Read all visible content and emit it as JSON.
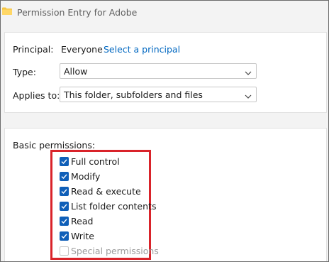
{
  "window": {
    "title": "Permission Entry for Adobe"
  },
  "principal": {
    "label": "Principal:",
    "value": "Everyone",
    "link": "Select a principal"
  },
  "type": {
    "label": "Type:",
    "selected": "Allow"
  },
  "applies_to": {
    "label": "Applies to:",
    "selected": "This folder, subfolders and files"
  },
  "basic_permissions": {
    "heading": "Basic permissions:",
    "items": [
      {
        "label": "Full control",
        "checked": true,
        "enabled": true
      },
      {
        "label": "Modify",
        "checked": true,
        "enabled": true
      },
      {
        "label": "Read & execute",
        "checked": true,
        "enabled": true
      },
      {
        "label": "List folder contents",
        "checked": true,
        "enabled": true
      },
      {
        "label": "Read",
        "checked": true,
        "enabled": true
      },
      {
        "label": "Write",
        "checked": true,
        "enabled": true
      },
      {
        "label": "Special permissions",
        "checked": false,
        "enabled": false
      }
    ]
  },
  "colors": {
    "checkbox_accent": "#0f5fb8",
    "link": "#0067c0",
    "highlight_border": "#d9232a",
    "folder_icon": "#f5c542"
  },
  "icons": {
    "folder": "folder-icon",
    "dropdown": "chevron-down-icon",
    "check": "checkmark-icon"
  }
}
